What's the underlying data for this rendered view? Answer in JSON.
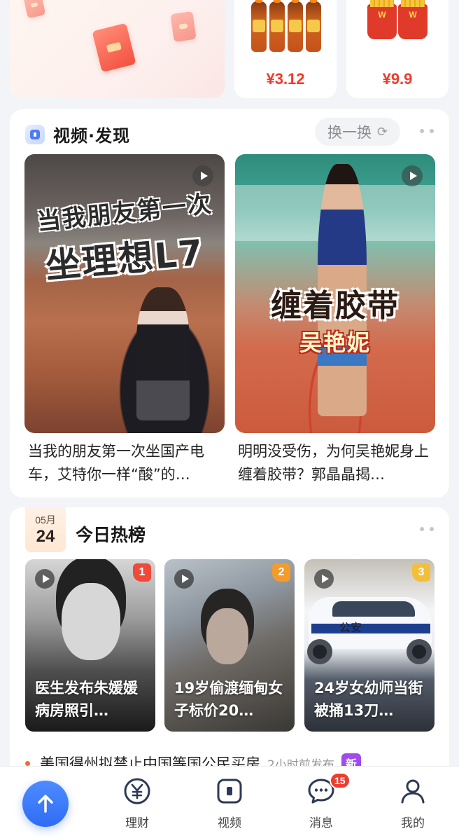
{
  "promo": {
    "items": [
      {
        "price": "¥3.12"
      },
      {
        "price": "¥9.9",
        "logo": "W"
      }
    ]
  },
  "video_section": {
    "title": "视频·发现",
    "refresh_label": "换一换",
    "videos": [
      {
        "overlay_line1": "当我朋友第一次",
        "overlay_line2": "坐理想L7",
        "caption": "当我的朋友第一次坐国产电车，艾特你一样“酸”的…"
      },
      {
        "overlay_line1": "缠着胶带",
        "overlay_line2": "吴艳妮",
        "caption": "明明没受伤，为何吴艳妮身上缠着胶带？郭晶晶揭…"
      }
    ]
  },
  "hot_section": {
    "date_month": "05月",
    "date_day": "24",
    "title": "今日热榜",
    "items": [
      {
        "rank": "1",
        "caption": "医生发布朱媛媛病房照引…"
      },
      {
        "rank": "2",
        "caption": "19岁偷渡缅甸女子标价20…"
      },
      {
        "rank": "3",
        "caption": "24岁女幼师当街被捅13刀…",
        "image_text": "公安"
      }
    ],
    "news": {
      "text": "美国得州拟禁止中国等国公民买房",
      "time": "2小时前发布",
      "badge": "新"
    }
  },
  "tabbar": {
    "items": [
      {
        "label": "理财",
        "icon": "yuan-icon"
      },
      {
        "label": "视频",
        "icon": "video-icon"
      },
      {
        "label": "消息",
        "icon": "chat-icon",
        "badge": "15"
      },
      {
        "label": "我的",
        "icon": "user-icon"
      }
    ]
  },
  "colors": {
    "accent": "#2f6cf5",
    "price_red": "#f23a2b",
    "rank1": "#f0493a",
    "rank2": "#f49b2c",
    "rank3": "#f3be3a",
    "new_badge": "#a04bf0"
  }
}
